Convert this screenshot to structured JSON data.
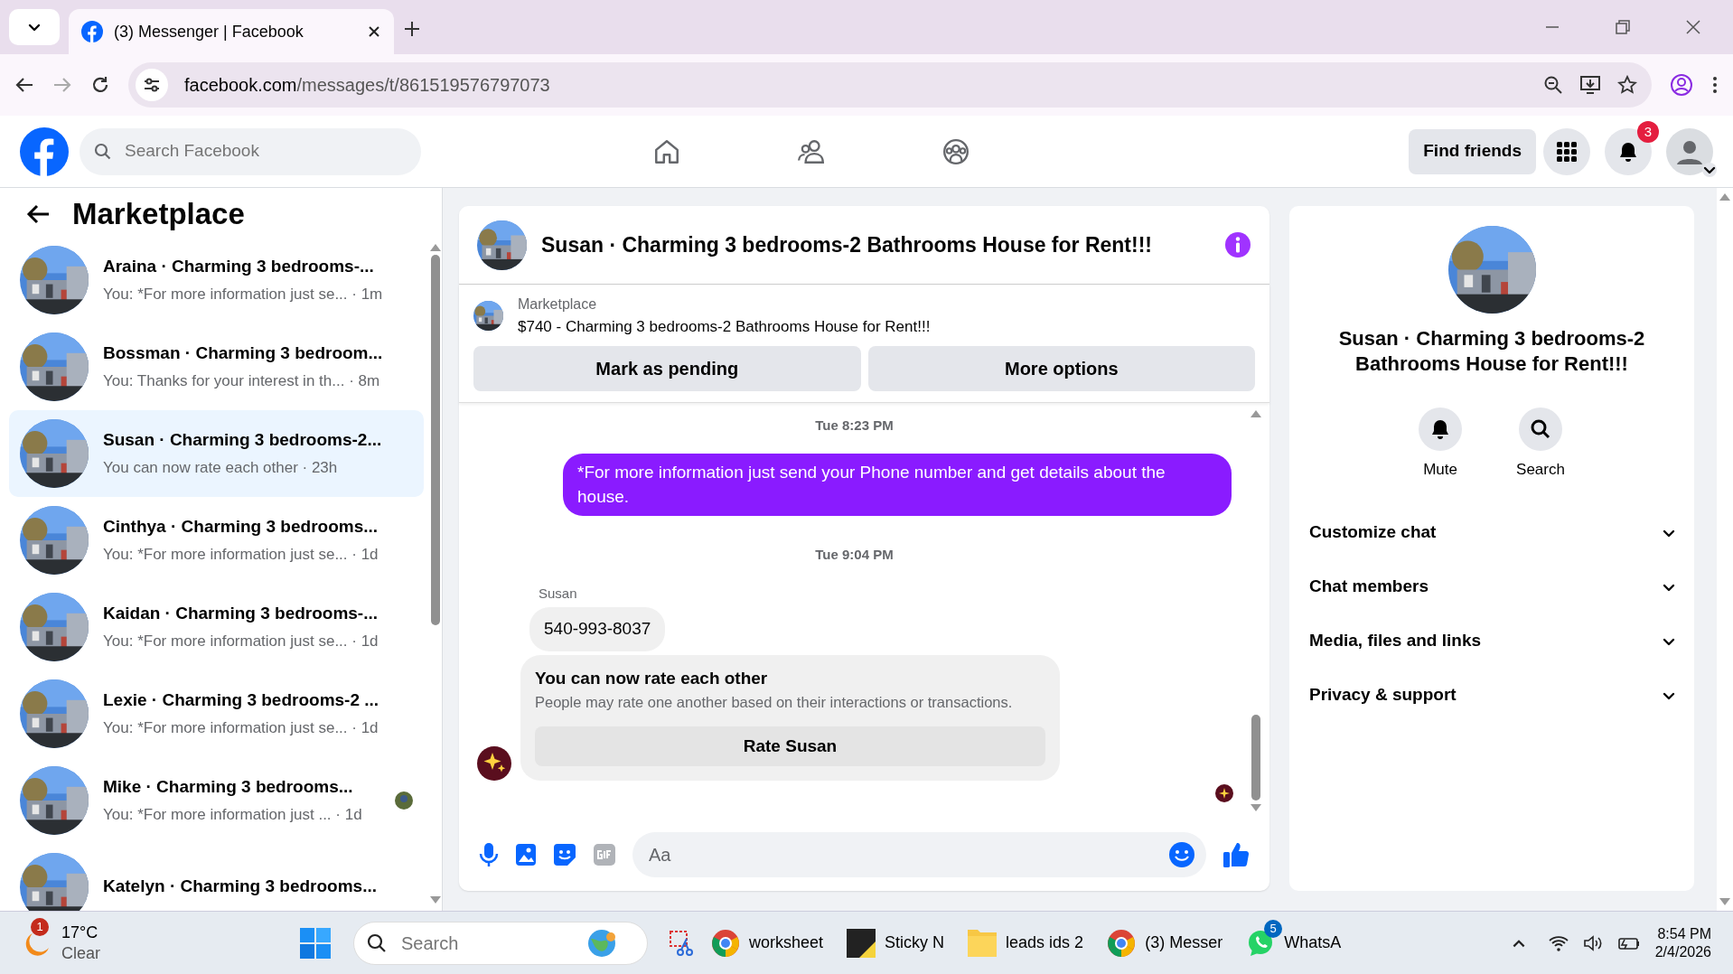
{
  "browser": {
    "tabs": [
      {
        "title": "(3) Messenger | Facebook",
        "selected": true
      }
    ],
    "url_domain": "facebook.com",
    "url_path": "/messages/t/861519576797073"
  },
  "header": {
    "search_placeholder": "Search Facebook",
    "nav": [
      {
        "kind": "home"
      },
      {
        "kind": "friends"
      },
      {
        "kind": "groups"
      }
    ],
    "find_friends": "Find friends",
    "notification_count": "3"
  },
  "sidebar": {
    "title": "Marketplace",
    "conversations": [
      {
        "name": "Araina · Charming 3 bedrooms-...",
        "preview": "You: *For more information just se... · 1m",
        "selected": false,
        "read_receipt": false
      },
      {
        "name": "Bossman · Charming 3 bedroom...",
        "preview": "You: Thanks for your interest in th... · 8m",
        "selected": false,
        "read_receipt": false
      },
      {
        "name": "Susan · Charming 3 bedrooms-2...",
        "preview": "You can now rate each other · 23h",
        "selected": true,
        "read_receipt": false
      },
      {
        "name": "Cinthya · Charming 3 bedrooms...",
        "preview": "You: *For more information just se... · 1d",
        "selected": false,
        "read_receipt": false
      },
      {
        "name": "Kaidan · Charming 3 bedrooms-...",
        "preview": "You: *For more information just se... · 1d",
        "selected": false,
        "read_receipt": false
      },
      {
        "name": "Lexie · Charming 3 bedrooms-2 ...",
        "preview": "You: *For more information just se... · 1d",
        "selected": false,
        "read_receipt": false
      },
      {
        "name": "Mike · Charming 3 bedrooms...",
        "preview": "You: *For more information just ... · 1d",
        "selected": false,
        "read_receipt": true
      },
      {
        "name": "Katelyn · Charming 3 bedrooms...",
        "selected": false,
        "read_receipt": false
      }
    ]
  },
  "chat": {
    "title": "Susan · Charming 3 bedrooms-2 Bathrooms House for Rent!!!",
    "listing": {
      "source": "Marketplace",
      "text": "$740 - Charming 3 bedrooms-2 Bathrooms House for Rent!!!"
    },
    "actions": [
      "Mark as pending",
      "More options"
    ],
    "messages": [
      {
        "kind": "timestamp",
        "text": "Tue 8:23 PM"
      },
      {
        "kind": "outgoing",
        "text": "*For more information just send your Phone number and  get details about the house."
      },
      {
        "kind": "timestamp",
        "text": "Tue 9:04 PM"
      },
      {
        "kind": "sender",
        "text": "Susan"
      },
      {
        "kind": "incoming",
        "text": "540-993-8037"
      },
      {
        "kind": "rating",
        "title": "You can now rate each other",
        "text": "People may rate one another based on their interactions or transactions.",
        "button": "Rate Susan"
      }
    ],
    "composer": {
      "placeholder": "Aa"
    }
  },
  "details": {
    "title": "Susan · Charming 3 bedrooms-2 Bathrooms House for Rent!!!",
    "actions": [
      {
        "kind": "mute",
        "label": "Mute"
      },
      {
        "kind": "search",
        "label": "Search"
      }
    ],
    "sections": [
      "Customize chat",
      "Chat members",
      "Media, files and links",
      "Privacy & support"
    ]
  },
  "taskbar": {
    "weather": {
      "badge": "1",
      "temperature": "17°C",
      "condition": "Clear"
    },
    "search_placeholder": "Search",
    "apps": [
      {
        "kind": "snip"
      },
      {
        "kind": "chrome",
        "label": "worksheet"
      },
      {
        "kind": "sticky",
        "label": "Sticky N"
      },
      {
        "kind": "folder",
        "label": "leads ids 2"
      },
      {
        "kind": "chrome",
        "label": "(3) Messer"
      },
      {
        "kind": "whatsapp",
        "label": "WhatsA",
        "badge": "5"
      }
    ],
    "time": "8:54 PM",
    "date": "2/4/2026"
  }
}
